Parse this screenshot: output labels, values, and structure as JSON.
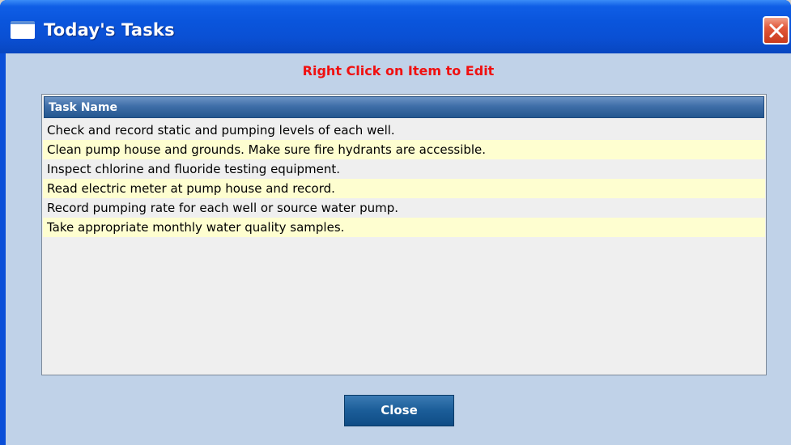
{
  "window": {
    "title": "Today's Tasks",
    "title_icon": "window-icon",
    "close_icon": "close-icon"
  },
  "hint": "Right Click on Item to Edit",
  "list": {
    "column_header": "Task Name",
    "rows": [
      "Check and record static and pumping levels of each well.",
      "Clean pump house and grounds. Make sure fire hydrants are accessible.",
      "Inspect chlorine and fluoride testing equipment.",
      "Read electric meter at pump house and record.",
      "Record pumping rate for each well or source water pump.",
      "Take appropriate monthly water quality samples."
    ]
  },
  "buttons": {
    "close_label": "Close"
  },
  "colors": {
    "titlebar": "#0a55dc",
    "client_bg": "#c0d2e8",
    "hint_text": "#f01010",
    "row_odd": "#efefef",
    "row_even": "#fefed0",
    "header_bg": "#3f6ea8",
    "button_bg": "#1b5d98"
  }
}
